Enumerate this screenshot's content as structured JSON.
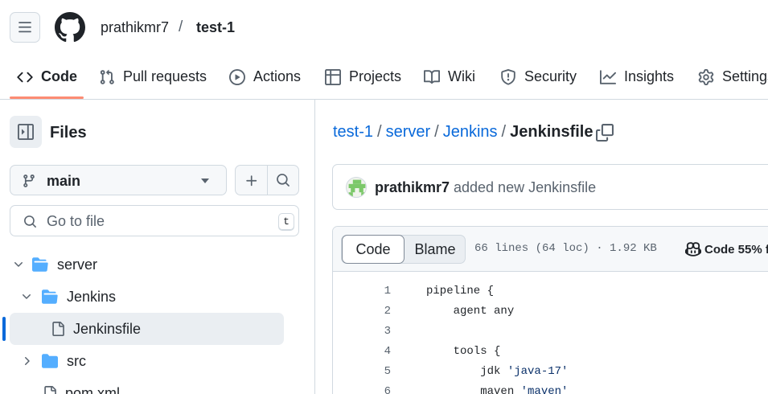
{
  "header": {
    "owner": "prathikmr7",
    "separator": "/",
    "repo": "test-1"
  },
  "tabs": [
    {
      "label": "Code",
      "icon": "code-icon",
      "active": true
    },
    {
      "label": "Pull requests",
      "icon": "git-pull-request-icon"
    },
    {
      "label": "Actions",
      "icon": "play-icon"
    },
    {
      "label": "Projects",
      "icon": "table-icon"
    },
    {
      "label": "Wiki",
      "icon": "book-icon"
    },
    {
      "label": "Security",
      "icon": "shield-icon"
    },
    {
      "label": "Insights",
      "icon": "graph-icon"
    },
    {
      "label": "Settings",
      "icon": "gear-icon"
    }
  ],
  "sidebar": {
    "title": "Files",
    "branch": "main",
    "search_placeholder": "Go to file",
    "search_shortcut": "t",
    "tree": [
      {
        "label": "server",
        "type": "folder",
        "expanded": true
      },
      {
        "label": "Jenkins",
        "type": "folder",
        "expanded": true
      },
      {
        "label": "Jenkinsfile",
        "type": "file",
        "selected": true
      },
      {
        "label": "src",
        "type": "folder",
        "expanded": false
      },
      {
        "label": "pom.xml",
        "type": "file"
      }
    ]
  },
  "breadcrumb": {
    "parts": [
      "test-1",
      "server",
      "Jenkins"
    ],
    "separator": "/",
    "current": "Jenkinsfile"
  },
  "commit": {
    "author": "prathikmr7",
    "message": "added new Jenkinsfile"
  },
  "file": {
    "view_tabs": [
      "Code",
      "Blame"
    ],
    "info": "66 lines (64 loc) · 1.92 KB",
    "code_stat": "Code 55% f",
    "lines": [
      {
        "n": "1",
        "text": "pipeline {"
      },
      {
        "n": "2",
        "text": "    agent any"
      },
      {
        "n": "3",
        "text": ""
      },
      {
        "n": "4",
        "text": "    tools {"
      },
      {
        "n": "5",
        "text": "        jdk ",
        "str": "'java-17'"
      },
      {
        "n": "6",
        "text": "        maven ",
        "str": "'maven'"
      }
    ]
  },
  "colors": {
    "link": "#0969da",
    "folder": "#54aeff",
    "active_tab_underline": "#fd8c73",
    "border": "#d1d9e0",
    "muted_text": "#59636e"
  }
}
